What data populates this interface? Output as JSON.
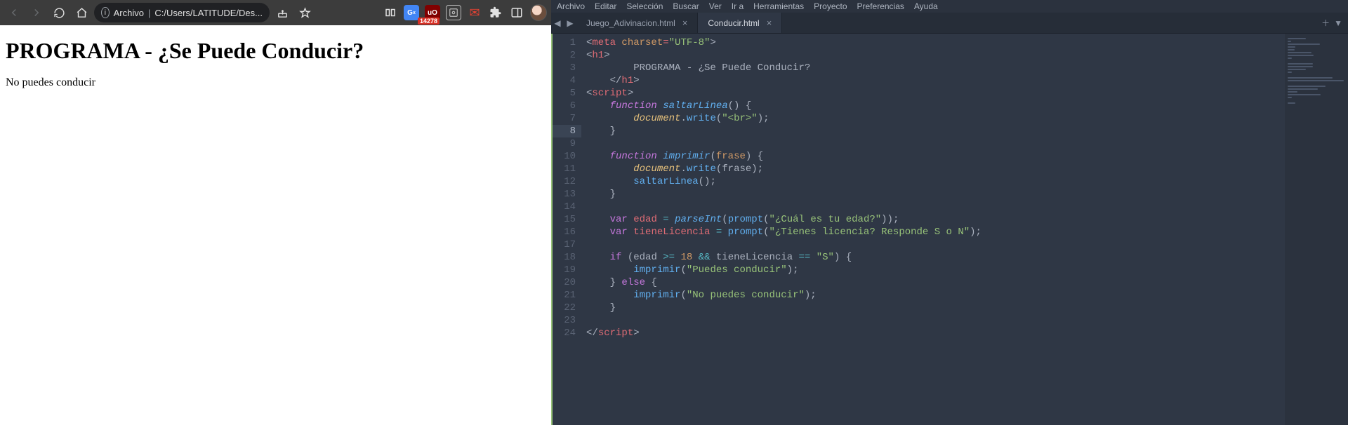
{
  "browser": {
    "url_label": "Archivo",
    "url_path": "C:/Users/LATITUDE/Des...",
    "badge": "14278",
    "page": {
      "heading": "PROGRAMA - ¿Se Puede Conducir?",
      "body": "No puedes conducir"
    }
  },
  "editor": {
    "menu": [
      "Archivo",
      "Editar",
      "Selección",
      "Buscar",
      "Ver",
      "Ir a",
      "Herramientas",
      "Proyecto",
      "Preferencias",
      "Ayuda"
    ],
    "tabs": [
      {
        "label": "Juego_Adivinacion.html",
        "active": false
      },
      {
        "label": "Conducir.html",
        "active": true
      }
    ],
    "active_line": 8,
    "lines": [
      {
        "n": 1,
        "indent": 0,
        "tokens": [
          [
            "angle",
            "<"
          ],
          [
            "tag",
            "meta"
          ],
          [
            "plain",
            " "
          ],
          [
            "attr",
            "charset"
          ],
          [
            "eq",
            "="
          ],
          [
            "str",
            "\"UTF-8\""
          ],
          [
            "angle",
            ">"
          ]
        ]
      },
      {
        "n": 2,
        "indent": 0,
        "tokens": [
          [
            "angle",
            "<"
          ],
          [
            "tag",
            "h1"
          ],
          [
            "angle",
            ">"
          ]
        ]
      },
      {
        "n": 3,
        "indent": 2,
        "tokens": [
          [
            "plain",
            "PROGRAMA - ¿Se Puede Conducir?"
          ]
        ]
      },
      {
        "n": 4,
        "indent": 1,
        "tokens": [
          [
            "angle",
            "</"
          ],
          [
            "tag",
            "h1"
          ],
          [
            "angle",
            ">"
          ]
        ]
      },
      {
        "n": 5,
        "indent": 0,
        "tokens": [
          [
            "angle",
            "<"
          ],
          [
            "tag",
            "script"
          ],
          [
            "angle",
            ">"
          ]
        ]
      },
      {
        "n": 6,
        "indent": 1,
        "tokens": [
          [
            "kw",
            "function"
          ],
          [
            "plain",
            " "
          ],
          [
            "fn-i",
            "saltarLinea"
          ],
          [
            "punc",
            "() {"
          ]
        ]
      },
      {
        "n": 7,
        "indent": 2,
        "tokens": [
          [
            "obj",
            "document"
          ],
          [
            "punc",
            "."
          ],
          [
            "fn",
            "write"
          ],
          [
            "punc",
            "("
          ],
          [
            "str",
            "\"<br>\""
          ],
          [
            "punc",
            ");"
          ]
        ]
      },
      {
        "n": 8,
        "indent": 1,
        "tokens": [
          [
            "punc",
            "}"
          ]
        ]
      },
      {
        "n": 9,
        "indent": 0,
        "tokens": []
      },
      {
        "n": 10,
        "indent": 1,
        "tokens": [
          [
            "kw",
            "function"
          ],
          [
            "plain",
            " "
          ],
          [
            "fn-i",
            "imprimir"
          ],
          [
            "punc",
            "("
          ],
          [
            "param",
            "frase"
          ],
          [
            "punc",
            ") {"
          ]
        ]
      },
      {
        "n": 11,
        "indent": 2,
        "tokens": [
          [
            "obj",
            "document"
          ],
          [
            "punc",
            "."
          ],
          [
            "fn",
            "write"
          ],
          [
            "punc",
            "("
          ],
          [
            "plain",
            "frase"
          ],
          [
            "punc",
            ");"
          ]
        ]
      },
      {
        "n": 12,
        "indent": 2,
        "tokens": [
          [
            "fn",
            "saltarLinea"
          ],
          [
            "punc",
            "();"
          ]
        ]
      },
      {
        "n": 13,
        "indent": 1,
        "tokens": [
          [
            "punc",
            "}"
          ]
        ]
      },
      {
        "n": 14,
        "indent": 0,
        "tokens": []
      },
      {
        "n": 15,
        "indent": 1,
        "tokens": [
          [
            "kw2",
            "var"
          ],
          [
            "plain",
            " "
          ],
          [
            "var",
            "edad"
          ],
          [
            "plain",
            " "
          ],
          [
            "op",
            "="
          ],
          [
            "plain",
            " "
          ],
          [
            "fn-i",
            "parseInt"
          ],
          [
            "punc",
            "("
          ],
          [
            "fn",
            "prompt"
          ],
          [
            "punc",
            "("
          ],
          [
            "str",
            "\"¿Cuál es tu edad?\""
          ],
          [
            "punc",
            "));"
          ]
        ]
      },
      {
        "n": 16,
        "indent": 1,
        "tokens": [
          [
            "kw2",
            "var"
          ],
          [
            "plain",
            " "
          ],
          [
            "var",
            "tieneLicencia"
          ],
          [
            "plain",
            " "
          ],
          [
            "op",
            "="
          ],
          [
            "plain",
            " "
          ],
          [
            "fn",
            "prompt"
          ],
          [
            "punc",
            "("
          ],
          [
            "str",
            "\"¿Tienes licencia? Responde S o N\""
          ],
          [
            "punc",
            ");"
          ]
        ]
      },
      {
        "n": 17,
        "indent": 0,
        "tokens": []
      },
      {
        "n": 18,
        "indent": 1,
        "tokens": [
          [
            "kw2",
            "if"
          ],
          [
            "plain",
            " "
          ],
          [
            "punc",
            "("
          ],
          [
            "plain",
            "edad "
          ],
          [
            "op",
            ">="
          ],
          [
            "plain",
            " "
          ],
          [
            "num",
            "18"
          ],
          [
            "plain",
            " "
          ],
          [
            "op",
            "&&"
          ],
          [
            "plain",
            " tieneLicencia "
          ],
          [
            "op",
            "=="
          ],
          [
            "plain",
            " "
          ],
          [
            "str",
            "\"S\""
          ],
          [
            "punc",
            ") {"
          ]
        ]
      },
      {
        "n": 19,
        "indent": 2,
        "tokens": [
          [
            "fn",
            "imprimir"
          ],
          [
            "punc",
            "("
          ],
          [
            "str",
            "\"Puedes conducir\""
          ],
          [
            "punc",
            ");"
          ]
        ]
      },
      {
        "n": 20,
        "indent": 1,
        "tokens": [
          [
            "punc",
            "} "
          ],
          [
            "kw2",
            "else"
          ],
          [
            "punc",
            " {"
          ]
        ]
      },
      {
        "n": 21,
        "indent": 2,
        "tokens": [
          [
            "fn",
            "imprimir"
          ],
          [
            "punc",
            "("
          ],
          [
            "str",
            "\"No puedes conducir\""
          ],
          [
            "punc",
            ");"
          ]
        ]
      },
      {
        "n": 22,
        "indent": 1,
        "tokens": [
          [
            "punc",
            "}"
          ]
        ]
      },
      {
        "n": 23,
        "indent": 0,
        "tokens": []
      },
      {
        "n": 24,
        "indent": 0,
        "tokens": [
          [
            "angle",
            "</"
          ],
          [
            "tag",
            "script"
          ],
          [
            "angle",
            ">"
          ]
        ]
      }
    ]
  }
}
